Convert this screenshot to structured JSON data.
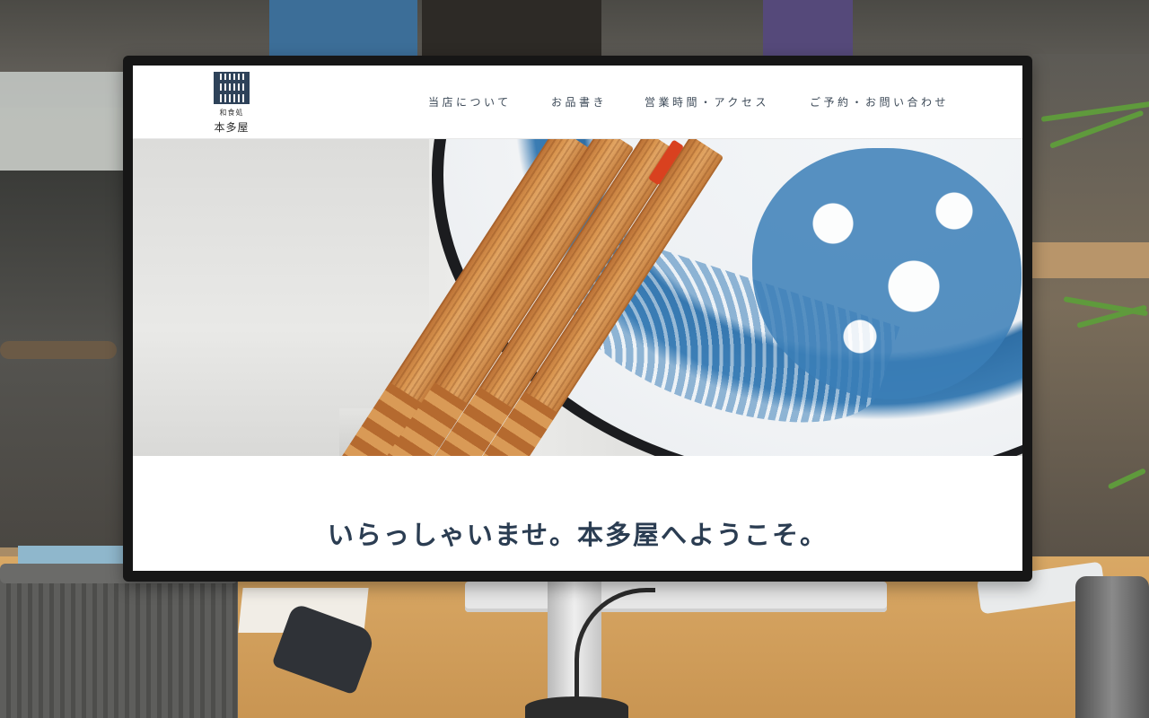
{
  "site": {
    "logo": {
      "subtitle": "和食処",
      "name": "本多屋"
    },
    "nav": [
      {
        "label": "当店について"
      },
      {
        "label": "お品書き"
      },
      {
        "label": "営業時間・アクセス"
      },
      {
        "label": "ご予約・お問い合わせ"
      }
    ],
    "welcome": "いらっしゃいませ。本多屋へようこそ。"
  },
  "colors": {
    "brand_navy": "#2e4259",
    "heading_text": "#2b3d52",
    "nav_text": "#3d4a58",
    "plate_blue": "#3b7fb8",
    "chopstick_wood": "#d9954f",
    "accent_red": "#d9411f"
  },
  "icons": {
    "logo": "lattice-logo-icon"
  }
}
